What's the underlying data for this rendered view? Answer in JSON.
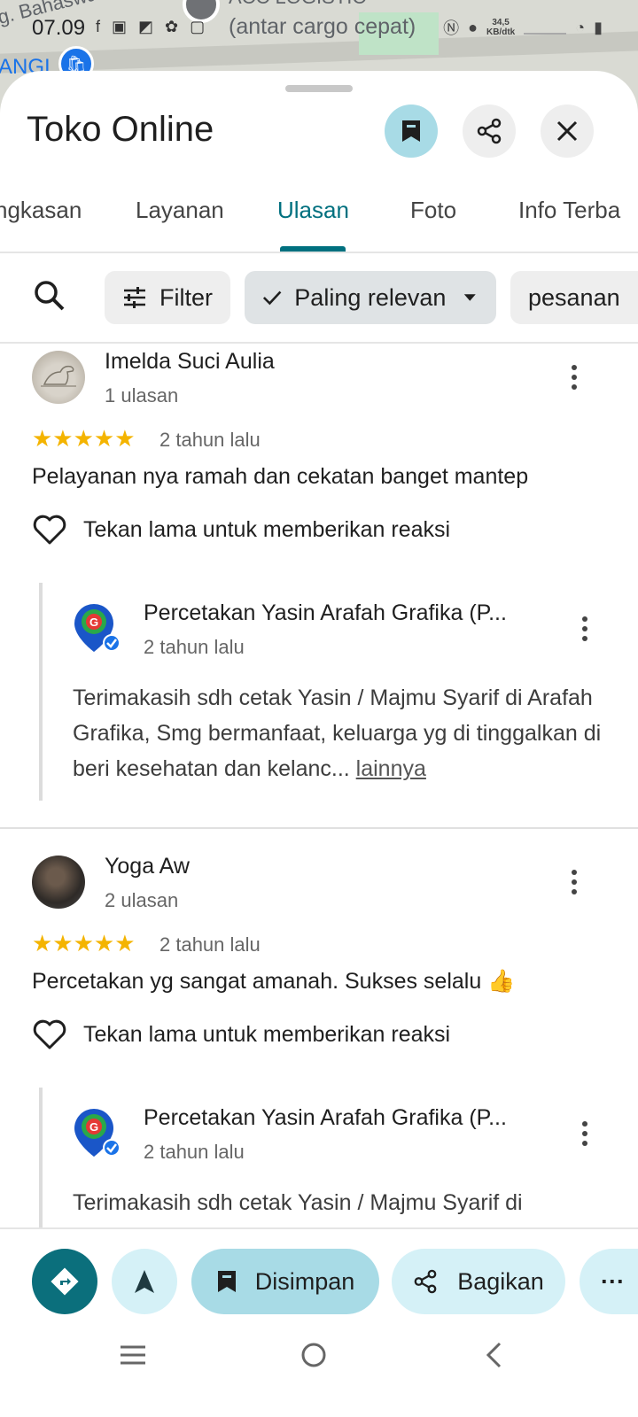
{
  "status": {
    "time": "07.09",
    "speed_value": "34,5",
    "speed_unit": "KB/dtk"
  },
  "map": {
    "label_top_left": "g. Bahaswan",
    "label_top_center": "ACC LOGISTIC",
    "label_second": "(antar cargo cepat)",
    "label_left": "ANGI"
  },
  "header": {
    "title": "Toko Online"
  },
  "tabs": [
    {
      "label": "ngkasan"
    },
    {
      "label": "Layanan"
    },
    {
      "label": "Ulasan"
    },
    {
      "label": "Foto"
    },
    {
      "label": "Info Terba"
    }
  ],
  "filters": {
    "filter_label": "Filter",
    "sort_label": "Paling relevan",
    "keyword_chip": "pesanan"
  },
  "reviews": [
    {
      "name": "Imelda Suci Aulia",
      "count": "1 ulasan",
      "stars": "★★★★★",
      "date": "2 tahun lalu",
      "text": "Pelayanan nya ramah dan cekatan banget mantep",
      "reaction_hint": "Tekan lama untuk memberikan reaksi",
      "owner": {
        "name": "Percetakan Yasin Arafah Grafika (P...",
        "date": "2 tahun lalu",
        "text": "Terimakasih sdh cetak Yasin / Majmu Syarif di Arafah Grafika, Smg bermanfaat, keluarga yg di tinggalkan di beri kesehatan dan kelanc...",
        "more": "lainnya"
      }
    },
    {
      "name": "Yoga Aw",
      "count": "2 ulasan",
      "stars": "★★★★★",
      "date": "2 tahun lalu",
      "text": "Percetakan yg sangat amanah. Sukses selalu 👍",
      "reaction_hint": "Tekan lama untuk memberikan reaksi",
      "owner": {
        "name": "Percetakan Yasin Arafah Grafika (P...",
        "date": "2 tahun lalu",
        "text": "Terimakasih sdh cetak Yasin / Majmu Syarif di"
      }
    }
  ],
  "actions": {
    "saved_label": "Disimpan",
    "share_label": "Bagikan",
    "more_label": "···"
  },
  "colors": {
    "accent": "#00707f",
    "saved_bg": "#a8dbe6",
    "chip_bg": "#eeeeee",
    "star": "#f4b400",
    "directions_bg": "#0b6f7c",
    "pill_bg": "#d5f1f7"
  }
}
